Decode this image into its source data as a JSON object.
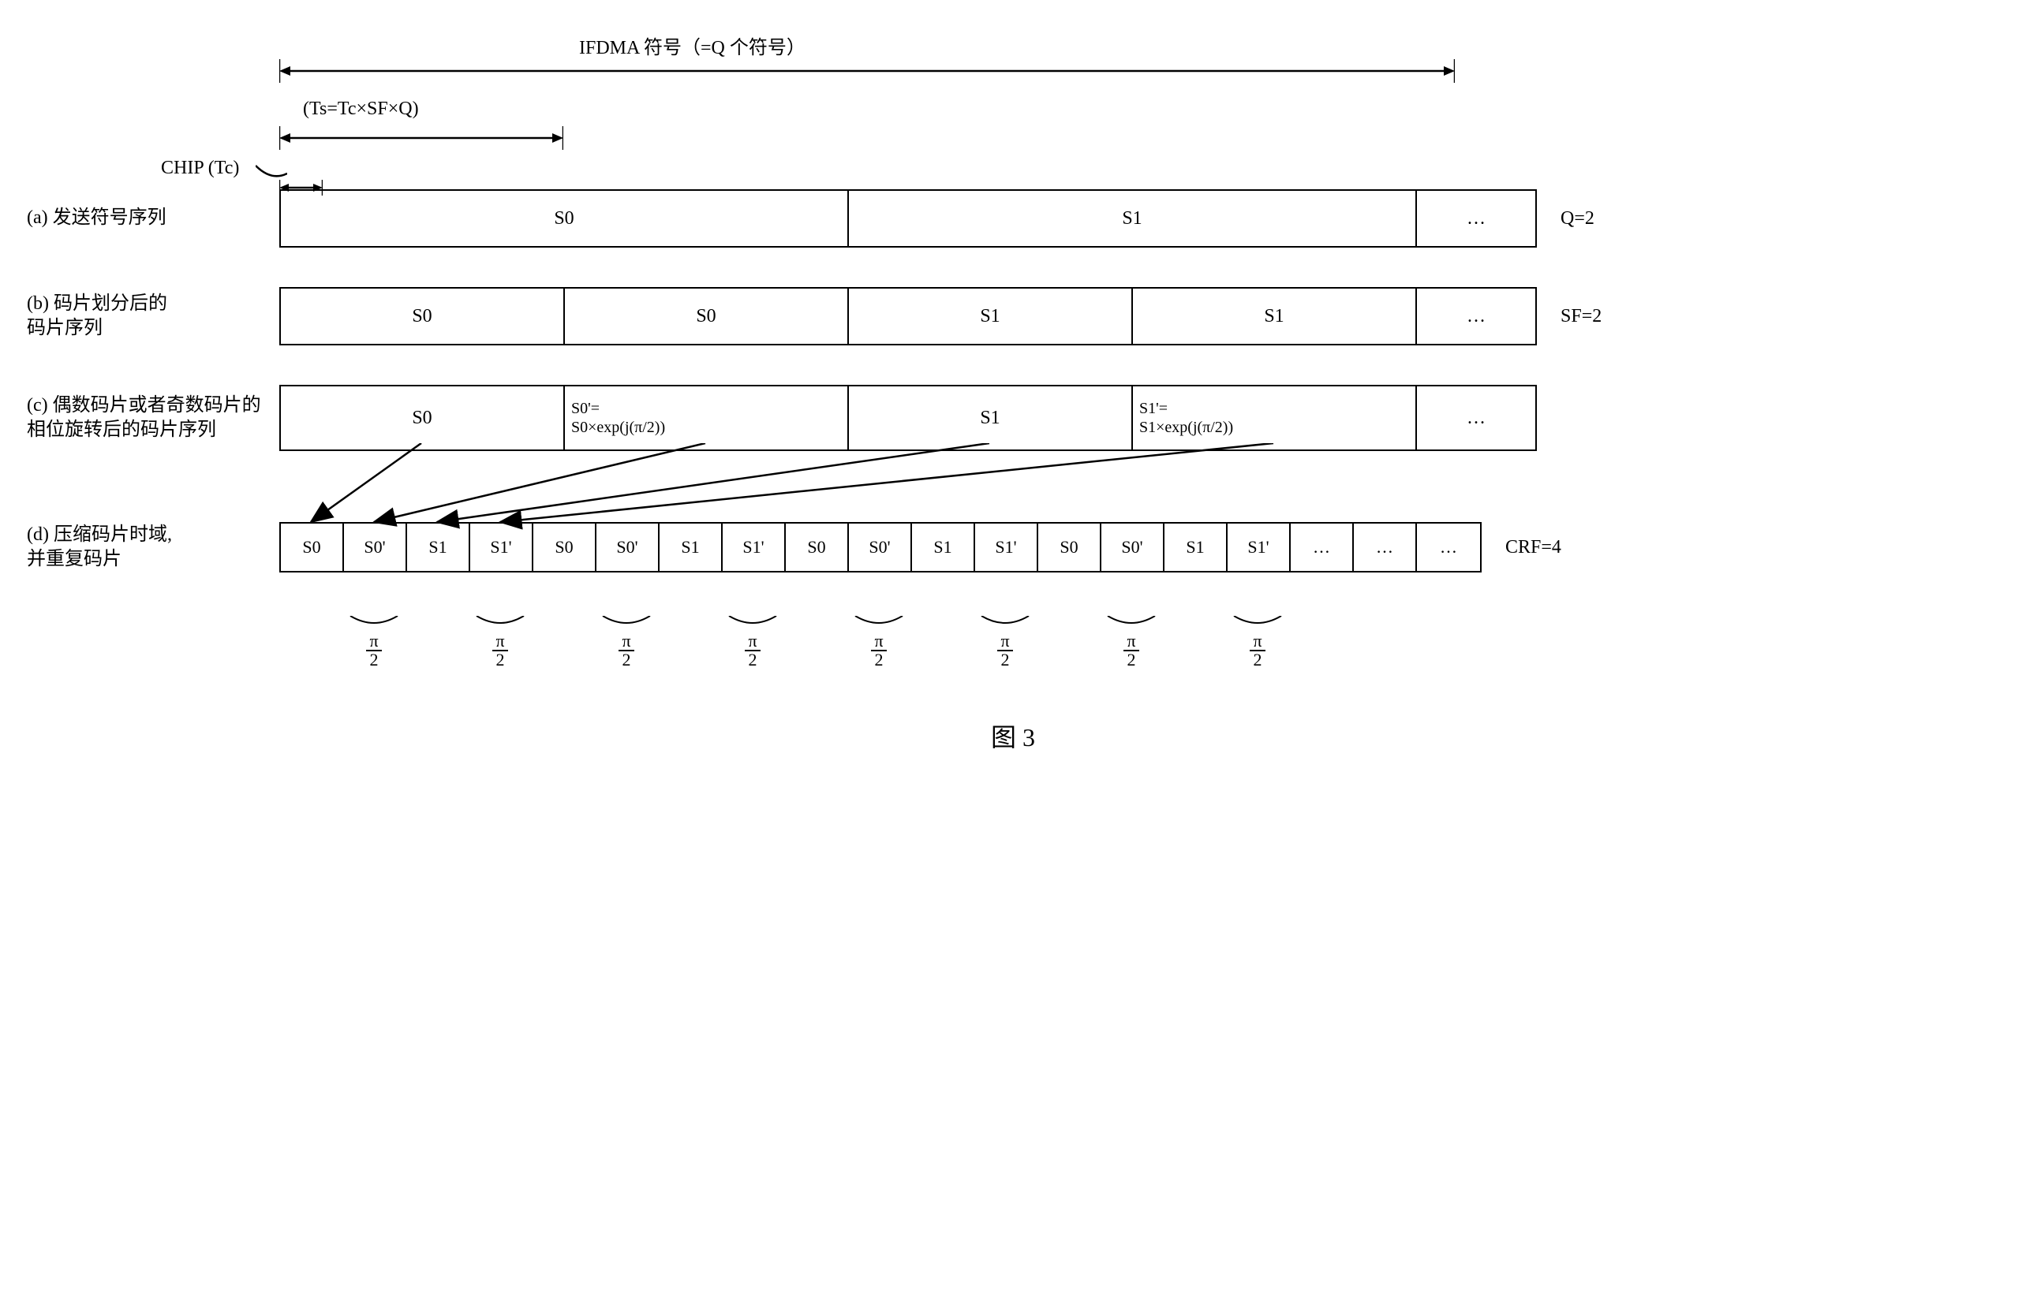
{
  "top": {
    "ifdma_label": "IFDMA 符号（=Q 个符号）",
    "ts_label": "(Ts=Tc×SF×Q)",
    "chip_label": "CHIP (Tc)"
  },
  "rows": {
    "a": {
      "label": "(a) 发送符号序列",
      "cells": [
        "S0",
        "S1",
        "…"
      ],
      "right": "Q=2"
    },
    "b": {
      "label": "(b) 码片划分后的\n码片序列",
      "cells": [
        "S0",
        "S0",
        "S1",
        "S1",
        "…"
      ],
      "right": "SF=2"
    },
    "c": {
      "label": "(c) 偶数码片或者奇数码片的相位旋转后的码片序列",
      "cells": [
        "S0",
        "S0'=\nS0×exp(j(π/2))",
        "S1",
        "S1'=\nS1×exp(j(π/2))",
        "…"
      ],
      "right": ""
    },
    "d": {
      "label": "(d) 压缩码片时域,\n并重复码片",
      "cells": [
        "S0",
        "S0'",
        "S1",
        "S1'",
        "S0",
        "S0'",
        "S1",
        "S1'",
        "S0",
        "S0'",
        "S1",
        "S1'",
        "S0",
        "S0'",
        "S1",
        "S1'",
        "…",
        "…",
        "…"
      ],
      "right": "CRF=4"
    }
  },
  "pi": {
    "top": "π",
    "bot": "2"
  },
  "figure": "图 3"
}
